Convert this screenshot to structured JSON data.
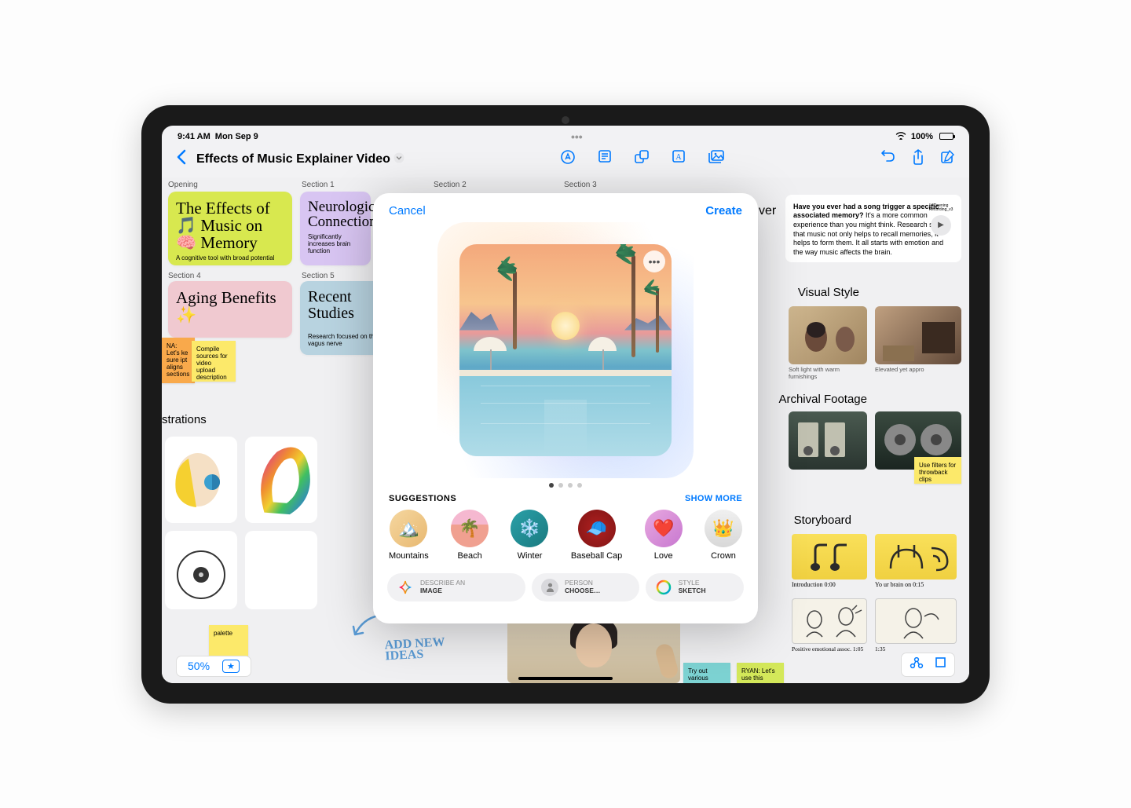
{
  "status": {
    "time": "9:41 AM",
    "date": "Mon Sep 9",
    "battery": "100%"
  },
  "toolbar": {
    "title": "Effects of Music Explainer Video"
  },
  "sections": {
    "opening": "Opening",
    "s1": "Section 1",
    "s2": "Section 2",
    "s3": "Section 3",
    "s4": "Section 4",
    "s5": "Section 5"
  },
  "cards": {
    "opening_title": "The Effects of 🎵 Music on 🧠 Memory",
    "opening_sub": "A cognitive tool with broad potential",
    "s1_title": "Neurological Connection",
    "s1_sub": "Significantly increases brain function",
    "s4_title": "Aging Benefits ✨",
    "s5_title": "Recent Studies",
    "s5_sub": "Research focused on the vagus nerve"
  },
  "stickies": {
    "nina": "NA: Let's ke sure ipt aligns sections",
    "compile": "Compile sources for video upload description",
    "filters": "Use filters for throwback clips",
    "tryout": "Try out various",
    "ryan": "RYAN: Let's use this",
    "palette": "palette"
  },
  "labels": {
    "illustrations": "strations",
    "visual_style": "Visual Style",
    "vs_cap1": "Soft light with warm furnishings",
    "vs_cap2": "Elevated yet appro",
    "archival": "Archival Footage",
    "storyboard": "Storyboard",
    "sb1": "Introduction 0:00",
    "sb2": "Yo ur brain on 0:15",
    "sb3": "Positive emotional assoc. 1:05",
    "sb4": "1:35",
    "ver": "ver",
    "handwriting": "ADD NEW IDEAS"
  },
  "textblock": {
    "q": "Have you ever had a song trigger a specific associated memory?",
    "body": " It's a more common experience than you might think. Research shows that music not only helps to recall memories, it helps to form them. It all starts with emotion and the way music affects the brain.",
    "filename": "Opening Recording_v3"
  },
  "zoom": {
    "value": "50%"
  },
  "modal": {
    "cancel": "Cancel",
    "create": "Create",
    "suggestions_label": "SUGGESTIONS",
    "show_more": "SHOW MORE",
    "items": [
      {
        "name": "Mountains",
        "emoji": "🏔️",
        "bg": "linear-gradient(135deg,#f5d7a0,#e8b870)"
      },
      {
        "name": "Beach",
        "emoji": "🌴",
        "bg": "linear-gradient(#f5b8d0 40%, #f0a090 40%)"
      },
      {
        "name": "Winter",
        "emoji": "❄️",
        "bg": "linear-gradient(135deg,#2aa0a8,#1a7a80)"
      },
      {
        "name": "Baseball Cap",
        "emoji": "🧢",
        "bg": "radial-gradient(circle,#b02020,#801515)"
      },
      {
        "name": "Love",
        "emoji": "❤️",
        "bg": "linear-gradient(135deg,#e8a8e0,#c878d0)"
      },
      {
        "name": "Crown",
        "emoji": "👑",
        "bg": "linear-gradient(#f0f0f0,#d8d8d8)"
      }
    ],
    "actions": {
      "describe_l1": "DESCRIBE AN",
      "describe_l2": "IMAGE",
      "person_l1": "PERSON",
      "person_l2": "CHOOSE…",
      "style_l1": "STYLE",
      "style_l2": "SKETCH"
    }
  }
}
